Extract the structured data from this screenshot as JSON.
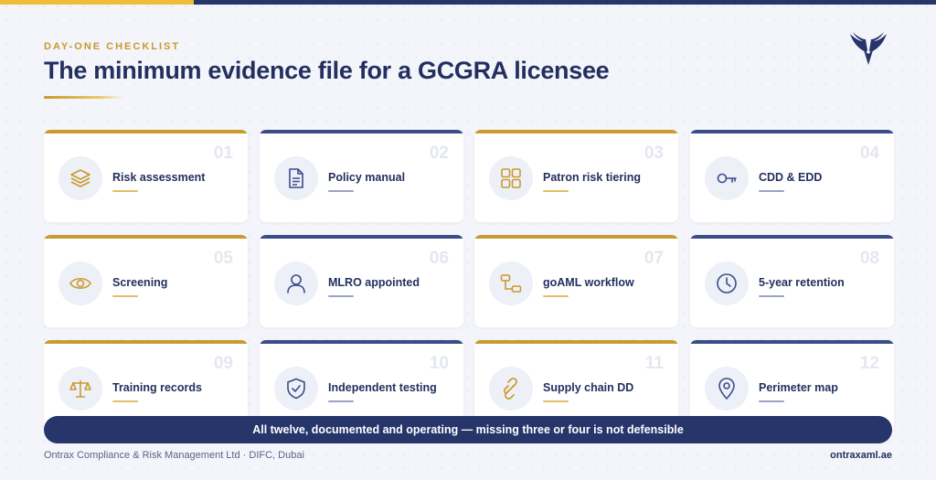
{
  "header": {
    "kicker": "DAY-ONE CHECKLIST",
    "title": "The minimum evidence file for a GCGRA licensee",
    "logo_icon": "wing-emblem-icon"
  },
  "colors": {
    "navy": "#26356a",
    "gold": "#c99a2e",
    "top_bar_gold": "#efbd3a"
  },
  "cards": [
    {
      "number": "01",
      "label": "Risk assessment",
      "icon": "layers-icon",
      "accent": "gold"
    },
    {
      "number": "02",
      "label": "Policy manual",
      "icon": "document-icon",
      "accent": "navy"
    },
    {
      "number": "03",
      "label": "Patron risk tiering",
      "icon": "grid-icon",
      "accent": "gold"
    },
    {
      "number": "04",
      "label": "CDD & EDD",
      "icon": "key-icon",
      "accent": "navy"
    },
    {
      "number": "05",
      "label": "Screening",
      "icon": "eye-icon",
      "accent": "gold"
    },
    {
      "number": "06",
      "label": "MLRO appointed",
      "icon": "user-icon",
      "accent": "navy"
    },
    {
      "number": "07",
      "label": "goAML workflow",
      "icon": "workflow-icon",
      "accent": "gold"
    },
    {
      "number": "08",
      "label": "5-year retention",
      "icon": "clock-icon",
      "accent": "navy"
    },
    {
      "number": "09",
      "label": "Training records",
      "icon": "scales-icon",
      "accent": "gold"
    },
    {
      "number": "10",
      "label": "Independent testing",
      "icon": "shield-check-icon",
      "accent": "navy"
    },
    {
      "number": "11",
      "label": "Supply chain DD",
      "icon": "chain-link-icon",
      "accent": "gold"
    },
    {
      "number": "12",
      "label": "Perimeter map",
      "icon": "map-pin-icon",
      "accent": "navy"
    }
  ],
  "banner": {
    "text": "All twelve, documented and operating — missing three or four is not defensible"
  },
  "footer": {
    "left": "Ontrax Compliance & Risk Management Ltd · DIFC, Dubai",
    "right": "ontraxaml.ae"
  }
}
